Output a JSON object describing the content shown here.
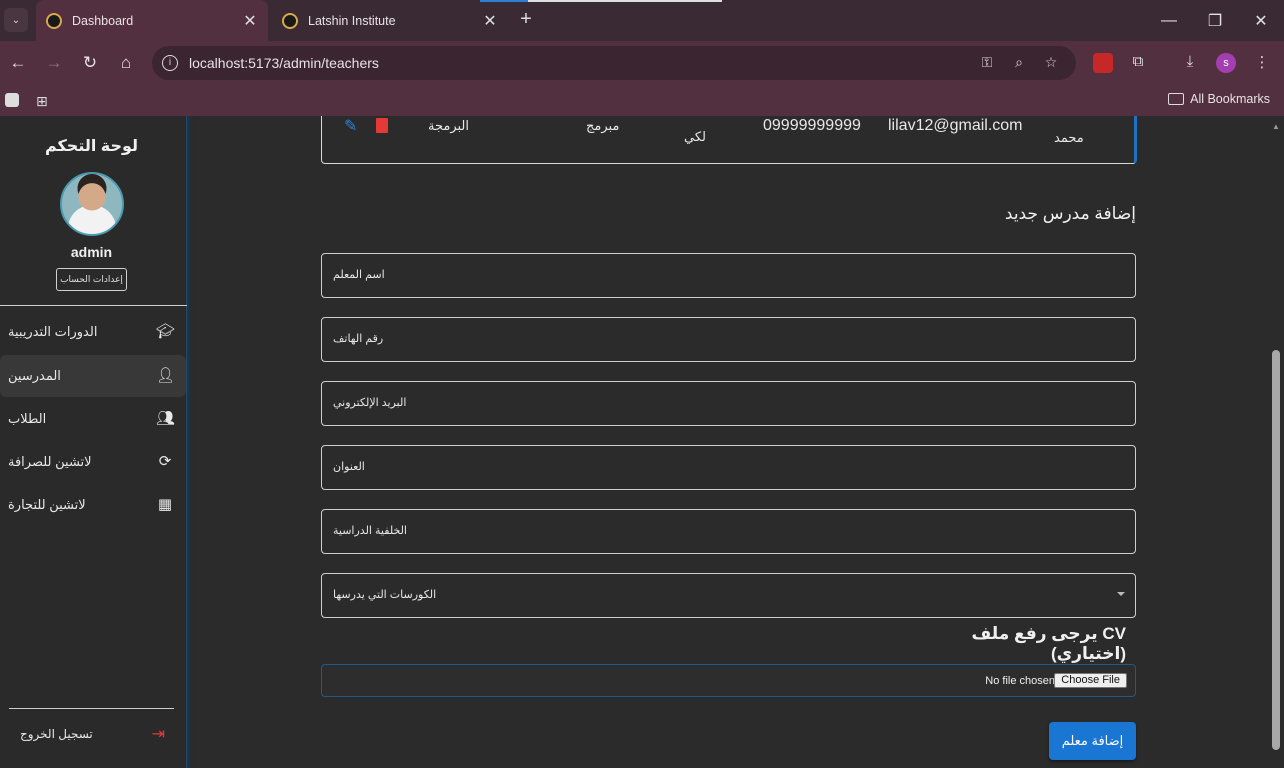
{
  "browser": {
    "tabs": [
      {
        "title": "Dashboard",
        "active": true
      },
      {
        "title": "Latshin Institute",
        "active": false
      }
    ],
    "url": "localhost:5173/admin/teachers",
    "profile_initial": "s",
    "bookmarks_label": "All Bookmarks"
  },
  "sidebar": {
    "title": "لوحة التحكم",
    "username": "admin",
    "settings_label": "إعدادات الحساب",
    "items": [
      {
        "label": "الدورات التدريبية",
        "icon": "school-icon"
      },
      {
        "label": "المدرسين",
        "icon": "person-icon",
        "active": true
      },
      {
        "label": "الطلاب",
        "icon": "people-icon"
      },
      {
        "label": "لاتشين للصرافة",
        "icon": "currency-exchange-icon"
      },
      {
        "label": "لاتشين للتجارة",
        "icon": "building-icon"
      }
    ],
    "logout_label": "تسجيل الخروج"
  },
  "table_row": {
    "name": "محمد",
    "email": "lilav12@gmail.com",
    "phone": "09999999999",
    "address": "لكي",
    "background": "مبرمج",
    "courses": "البرمجة"
  },
  "form": {
    "title": "إضافة مدرس جديد",
    "fields": {
      "name": "اسم المعلم",
      "phone": "رقم الهاتف",
      "email": "البريد الإلكتروني",
      "address": "العنوان",
      "background": "الخلفية الدراسية",
      "courses": "الكورسات التي يدرسها"
    },
    "cv_label": "يرجى رفع ملف CV (اختياري)",
    "file_status": "No file chosen",
    "choose_file": "Choose File",
    "submit_label": "إضافة معلم"
  }
}
